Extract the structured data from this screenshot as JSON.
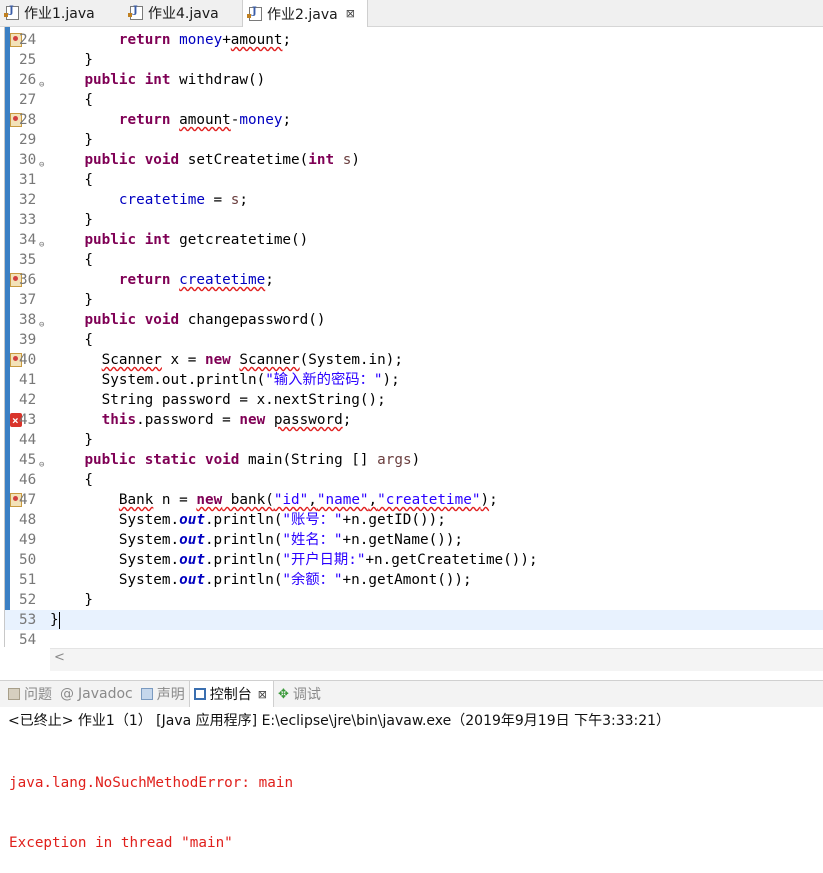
{
  "tabs": [
    {
      "label": "作业1.java",
      "active": false
    },
    {
      "label": "作业4.java",
      "active": false
    },
    {
      "label": "作业2.java",
      "active": true,
      "close": "⊠"
    }
  ],
  "code_lines": [
    {
      "n": "24",
      "marker": "warn",
      "fold": "",
      "current": false,
      "html": "        <span class=\"kw\">return</span> <span class=\"fld\">money</span>+<span class=\"sq\">amount</span>;"
    },
    {
      "n": "25",
      "marker": "",
      "fold": "",
      "current": false,
      "html": "    }"
    },
    {
      "n": "26",
      "marker": "",
      "fold": "⊖",
      "current": false,
      "html": "    <span class=\"kw\">public</span> <span class=\"kw\">int</span> withdraw()"
    },
    {
      "n": "27",
      "marker": "",
      "fold": "",
      "current": false,
      "html": "    {"
    },
    {
      "n": "28",
      "marker": "warn",
      "fold": "",
      "current": false,
      "html": "        <span class=\"kw\">return</span> <span class=\"sq\">amount</span>-<span class=\"fld\">money</span>;"
    },
    {
      "n": "29",
      "marker": "",
      "fold": "",
      "current": false,
      "html": "    }"
    },
    {
      "n": "30",
      "marker": "",
      "fold": "⊖",
      "current": false,
      "html": "    <span class=\"kw\">public</span> <span class=\"kw\">void</span> setCreatetime(<span class=\"kw\">int</span> <span class=\"par\">s</span>)"
    },
    {
      "n": "31",
      "marker": "",
      "fold": "",
      "current": false,
      "html": "    {"
    },
    {
      "n": "32",
      "marker": "",
      "fold": "",
      "current": false,
      "html": "        <span class=\"fld\">createtime</span> = <span class=\"par\">s</span>;"
    },
    {
      "n": "33",
      "marker": "",
      "fold": "",
      "current": false,
      "html": "    }"
    },
    {
      "n": "34",
      "marker": "",
      "fold": "⊖",
      "current": false,
      "html": "    <span class=\"kw\">public</span> <span class=\"kw\">int</span> getcreatetime()"
    },
    {
      "n": "35",
      "marker": "",
      "fold": "",
      "current": false,
      "html": "    {"
    },
    {
      "n": "36",
      "marker": "warn",
      "fold": "",
      "current": false,
      "html": "        <span class=\"kw\">return</span> <span class=\"fld sq\">createtime</span>;"
    },
    {
      "n": "37",
      "marker": "",
      "fold": "",
      "current": false,
      "html": "    }"
    },
    {
      "n": "38",
      "marker": "",
      "fold": "⊖",
      "current": false,
      "html": "    <span class=\"kw\">public</span> <span class=\"kw\">void</span> changepassword()"
    },
    {
      "n": "39",
      "marker": "",
      "fold": "",
      "current": false,
      "html": "    {"
    },
    {
      "n": "40",
      "marker": "warn",
      "fold": "",
      "current": false,
      "html": "      <span class=\"sq\">Scanner</span> x = <span class=\"kw\">new</span> <span class=\"sq\">Scanner</span>(System.in);"
    },
    {
      "n": "41",
      "marker": "",
      "fold": "",
      "current": false,
      "html": "      System.out.println(<span class=\"str\">\"输入新的密码：\"</span>);"
    },
    {
      "n": "42",
      "marker": "",
      "fold": "",
      "current": false,
      "html": "      String password = x.nextString();"
    },
    {
      "n": "43",
      "marker": "bad",
      "fold": "",
      "current": false,
      "html": "      <span class=\"kw\">this</span>.password = <span class=\"kw\">new</span> <span class=\"sq\">password</span>;"
    },
    {
      "n": "44",
      "marker": "",
      "fold": "",
      "current": false,
      "html": "    }"
    },
    {
      "n": "45",
      "marker": "",
      "fold": "⊖",
      "current": false,
      "html": "    <span class=\"kw\">public</span> <span class=\"kw\">static</span> <span class=\"kw\">void</span> main(String [] <span class=\"par\">args</span>)"
    },
    {
      "n": "46",
      "marker": "",
      "fold": "",
      "current": false,
      "html": "    {"
    },
    {
      "n": "47",
      "marker": "warn",
      "fold": "",
      "current": false,
      "html": "        <span class=\"sq\">Bank</span> n = <span class=\"kw sq\">new</span><span class=\"sq\"> bank(<span class=\"str\">\"id\"</span>,<span class=\"str\">\"name\"</span>,<span class=\"str\">\"createtime\"</span>)</span>;"
    },
    {
      "n": "48",
      "marker": "",
      "fold": "",
      "current": false,
      "html": "        System.<span class=\"st\">out</span>.println(<span class=\"str\">\"账号：\"</span>+n.getID());"
    },
    {
      "n": "49",
      "marker": "",
      "fold": "",
      "current": false,
      "html": "        System.<span class=\"st\">out</span>.println(<span class=\"str\">\"姓名：\"</span>+n.getName());"
    },
    {
      "n": "50",
      "marker": "",
      "fold": "",
      "current": false,
      "html": "        System.<span class=\"st\">out</span>.println(<span class=\"str\">\"开户日期:\"</span>+n.getCreatetime());"
    },
    {
      "n": "51",
      "marker": "",
      "fold": "",
      "current": false,
      "html": "        System.<span class=\"st\">out</span>.println(<span class=\"str\">\"余额：\"</span>+n.getAmont());"
    },
    {
      "n": "52",
      "marker": "",
      "fold": "",
      "current": false,
      "html": "    }"
    },
    {
      "n": "53",
      "marker": "",
      "fold": "",
      "current": true,
      "html": "}<span class=\"caret\"></span>"
    },
    {
      "n": "54",
      "marker": "",
      "fold": "",
      "current": false,
      "html": ""
    }
  ],
  "console": {
    "tabs": [
      {
        "label": "问题",
        "icon": "problems-icon",
        "active": false
      },
      {
        "label": "Javadoc",
        "icon": "javadoc-icon",
        "active": false
      },
      {
        "label": "声明",
        "icon": "declaration-icon",
        "active": false
      },
      {
        "label": "控制台",
        "icon": "console-icon",
        "active": true,
        "close": "⊠"
      },
      {
        "label": "调试",
        "icon": "debug-icon",
        "active": false
      }
    ],
    "status": "<已终止> 作业1（1） [Java 应用程序] E:\\eclipse\\jre\\bin\\javaw.exe（2019年9月19日 下午3:33:21）",
    "output": [
      "java.lang.NoSuchMethodError: main",
      "Exception in thread \"main\""
    ]
  },
  "colors": {
    "keyword": "#7f0055",
    "field": "#0000c0",
    "string": "#2a00ff",
    "error_text": "#e0201c",
    "ruler": "#3a7fc4"
  }
}
